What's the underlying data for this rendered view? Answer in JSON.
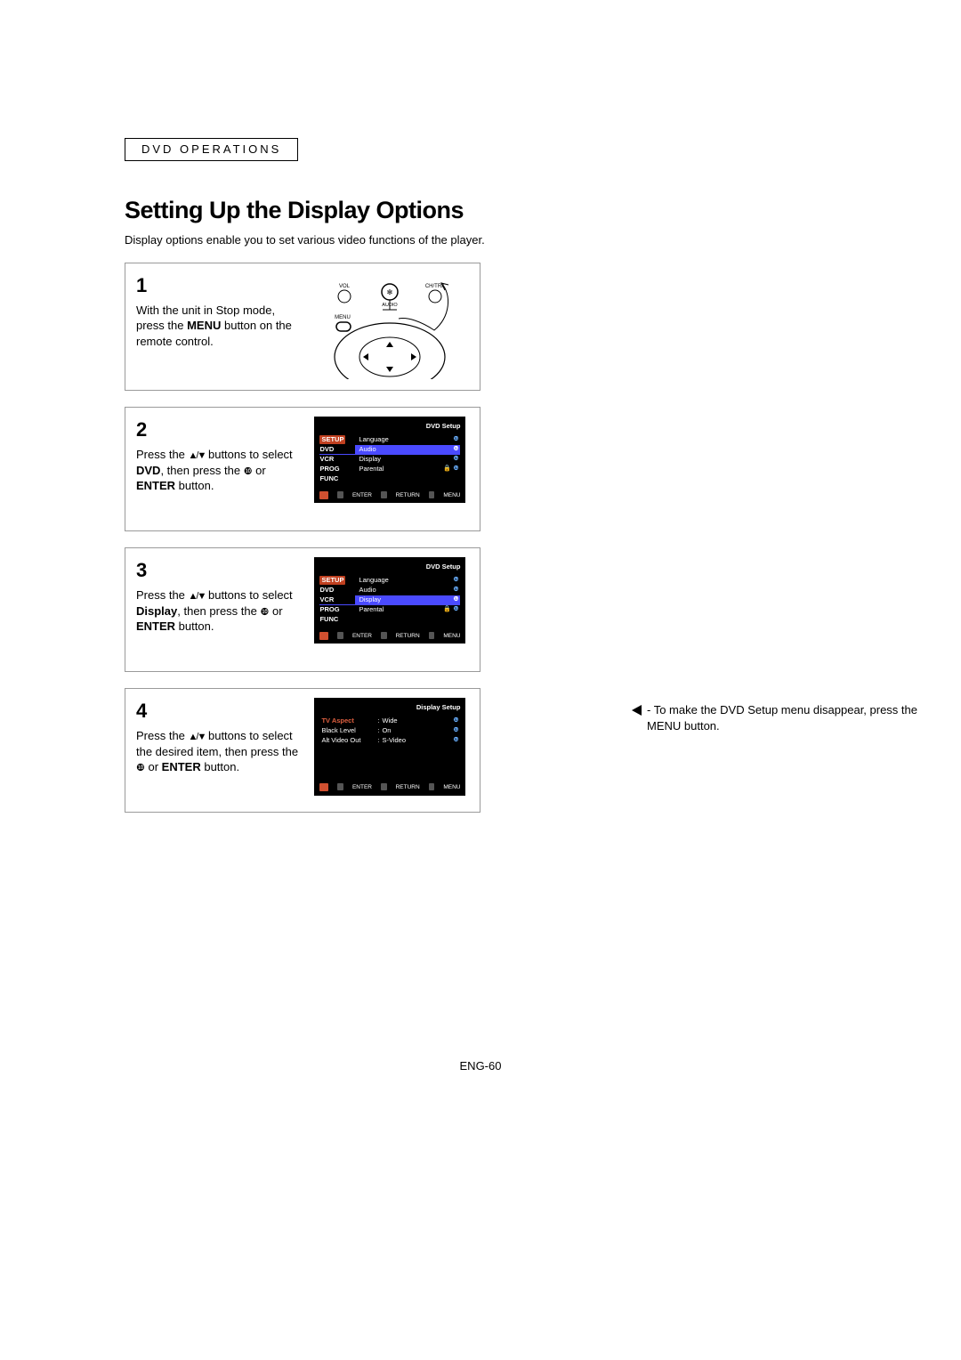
{
  "header": {
    "section": "DVD Operations"
  },
  "title": "Setting Up the Display Options",
  "intro": "Display options enable you to set various video functions of the player.",
  "steps": {
    "s1": {
      "num": "1",
      "text_a": "With the unit in Stop mode, press the ",
      "bold_a": "MENU",
      "text_b": " button on the remote control."
    },
    "s2": {
      "num": "2",
      "text_a": "Press the ",
      "text_b": " buttons to select ",
      "bold_a": "DVD",
      "text_c": ", then press the ",
      "text_d": " or ",
      "bold_b": "ENTER",
      "text_e": " button."
    },
    "s3": {
      "num": "3",
      "text_a": "Press the ",
      "text_b": " buttons to select ",
      "bold_a": "Display",
      "text_c": ", then press the ",
      "text_d": " or ",
      "bold_b": "ENTER",
      "text_e": " button."
    },
    "s4": {
      "num": "4",
      "text_a": "Press the ",
      "text_b": " buttons to select the desired item, then press the ",
      "text_d": " or ",
      "bold_b": "ENTER",
      "text_e": " button."
    }
  },
  "osd_dvd": {
    "title": "DVD Setup",
    "side": [
      "SETUP",
      "DVD",
      "VCR",
      "PROG",
      "FUNC"
    ],
    "items": [
      "Language",
      "Audio",
      "Display",
      "Parental"
    ],
    "foot": [
      "ENTER",
      "RETURN",
      "MENU"
    ]
  },
  "osd_display": {
    "title": "Display Setup",
    "rows": [
      {
        "label": "TV Aspect",
        "value": "Wide"
      },
      {
        "label": "Black Level",
        "value": "On"
      },
      {
        "label": "Alt Video Out",
        "value": "S-Video"
      }
    ],
    "foot": [
      "ENTER",
      "RETURN",
      "MENU"
    ]
  },
  "remote_labels": {
    "vol": "VOL",
    "chtrk": "CH/TRK",
    "audio": "AUDIO",
    "menu": "MENU"
  },
  "sidenote": {
    "dash": " - ",
    "text": "To make the DVD Setup menu disappear, press the MENU button."
  },
  "page_num": "ENG-60",
  "glyphs": {
    "updown": "▲/▼",
    "right": "❿",
    "lock": "🔒"
  }
}
